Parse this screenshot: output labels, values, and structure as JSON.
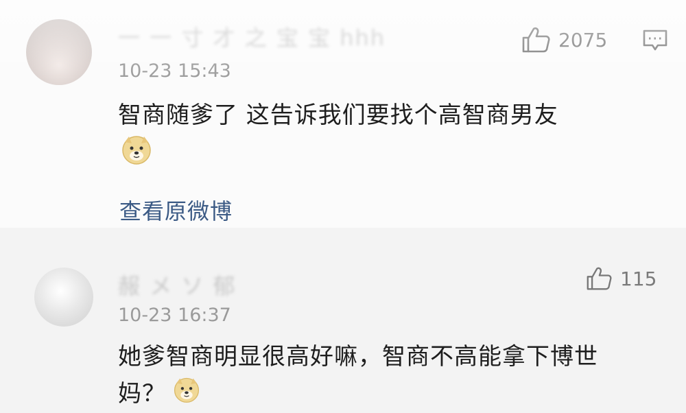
{
  "comments": [
    {
      "username": "一 一 寸 才 之 宝 宝 hhh",
      "time": "10-23 15:43",
      "likes": "2075",
      "content_lines": [
        "智商随爹了 这告诉我们要找个高智商男友"
      ],
      "view_link": "查看原微博"
    },
    {
      "username": "赧 メ ソ 郁",
      "time": "10-23 16:37",
      "likes": "115",
      "content_lines": [
        "她爹智商明显很高好嘛，智商不高能拿下博世",
        "妈？"
      ]
    }
  ],
  "icons": {
    "like": "thumbs-up-icon",
    "reply": "comment-bubble-icon",
    "emoji": "doge-emoji-icon"
  },
  "colors": {
    "link": "#3b5a85",
    "meta": "#9a9a9a"
  }
}
